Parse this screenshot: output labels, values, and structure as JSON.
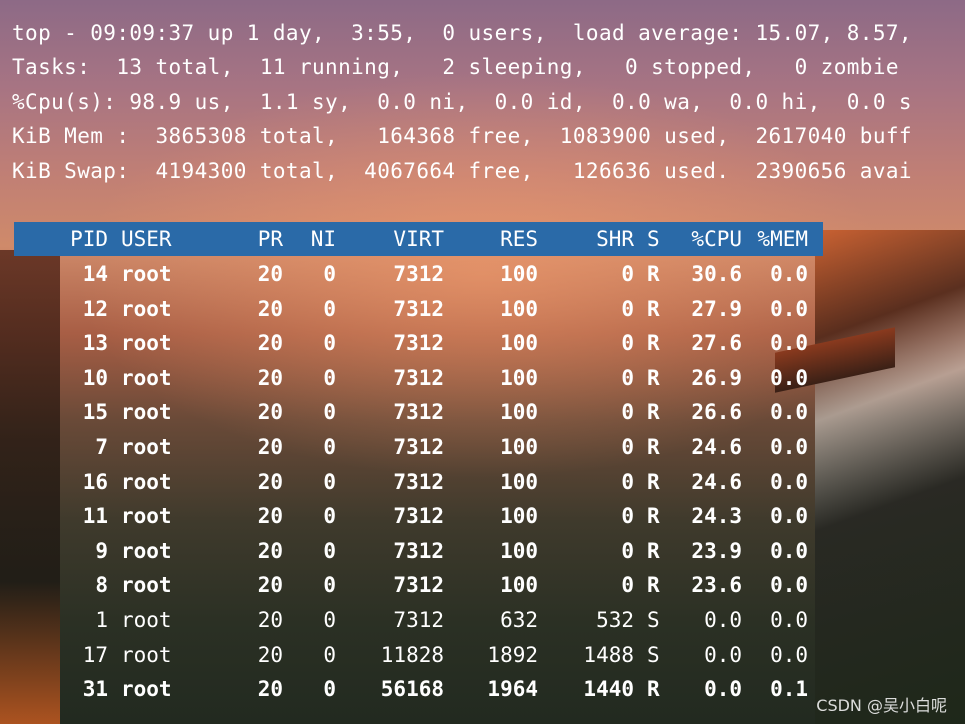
{
  "summary": [
    "top - 09:09:37 up 1 day,  3:55,  0 users,  load average: 15.07, 8.57,",
    "Tasks:  13 total,  11 running,   2 sleeping,   0 stopped,   0 zombie",
    "%Cpu(s): 98.9 us,  1.1 sy,  0.0 ni,  0.0 id,  0.0 wa,  0.0 hi,  0.0 s",
    "KiB Mem :  3865308 total,   164368 free,  1083900 used,  2617040 buff",
    "KiB Swap:  4194300 total,  4067664 free,   126636 used.  2390656 avai"
  ],
  "headers": {
    "pid": "PID",
    "user": "USER",
    "pr": "PR",
    "ni": "NI",
    "virt": "VIRT",
    "res": "RES",
    "shr": "SHR",
    "s": "S",
    "cpu": "%CPU",
    "mem": "%MEM"
  },
  "processes": [
    {
      "pid": "14",
      "user": "root",
      "pr": "20",
      "ni": "0",
      "virt": "7312",
      "res": "100",
      "shr": "0",
      "s": "R",
      "cpu": "30.6",
      "mem": "0.0",
      "bold": true
    },
    {
      "pid": "12",
      "user": "root",
      "pr": "20",
      "ni": "0",
      "virt": "7312",
      "res": "100",
      "shr": "0",
      "s": "R",
      "cpu": "27.9",
      "mem": "0.0",
      "bold": true
    },
    {
      "pid": "13",
      "user": "root",
      "pr": "20",
      "ni": "0",
      "virt": "7312",
      "res": "100",
      "shr": "0",
      "s": "R",
      "cpu": "27.6",
      "mem": "0.0",
      "bold": true
    },
    {
      "pid": "10",
      "user": "root",
      "pr": "20",
      "ni": "0",
      "virt": "7312",
      "res": "100",
      "shr": "0",
      "s": "R",
      "cpu": "26.9",
      "mem": "0.0",
      "bold": true
    },
    {
      "pid": "15",
      "user": "root",
      "pr": "20",
      "ni": "0",
      "virt": "7312",
      "res": "100",
      "shr": "0",
      "s": "R",
      "cpu": "26.6",
      "mem": "0.0",
      "bold": true
    },
    {
      "pid": "7",
      "user": "root",
      "pr": "20",
      "ni": "0",
      "virt": "7312",
      "res": "100",
      "shr": "0",
      "s": "R",
      "cpu": "24.6",
      "mem": "0.0",
      "bold": true
    },
    {
      "pid": "16",
      "user": "root",
      "pr": "20",
      "ni": "0",
      "virt": "7312",
      "res": "100",
      "shr": "0",
      "s": "R",
      "cpu": "24.6",
      "mem": "0.0",
      "bold": true
    },
    {
      "pid": "11",
      "user": "root",
      "pr": "20",
      "ni": "0",
      "virt": "7312",
      "res": "100",
      "shr": "0",
      "s": "R",
      "cpu": "24.3",
      "mem": "0.0",
      "bold": true
    },
    {
      "pid": "9",
      "user": "root",
      "pr": "20",
      "ni": "0",
      "virt": "7312",
      "res": "100",
      "shr": "0",
      "s": "R",
      "cpu": "23.9",
      "mem": "0.0",
      "bold": true
    },
    {
      "pid": "8",
      "user": "root",
      "pr": "20",
      "ni": "0",
      "virt": "7312",
      "res": "100",
      "shr": "0",
      "s": "R",
      "cpu": "23.6",
      "mem": "0.0",
      "bold": true
    },
    {
      "pid": "1",
      "user": "root",
      "pr": "20",
      "ni": "0",
      "virt": "7312",
      "res": "632",
      "shr": "532",
      "s": "S",
      "cpu": "0.0",
      "mem": "0.0",
      "bold": false
    },
    {
      "pid": "17",
      "user": "root",
      "pr": "20",
      "ni": "0",
      "virt": "11828",
      "res": "1892",
      "shr": "1488",
      "s": "S",
      "cpu": "0.0",
      "mem": "0.0",
      "bold": false
    },
    {
      "pid": "31",
      "user": "root",
      "pr": "20",
      "ni": "0",
      "virt": "56168",
      "res": "1964",
      "shr": "1440",
      "s": "R",
      "cpu": "0.0",
      "mem": "0.1",
      "bold": true
    }
  ],
  "watermark": "CSDN @吴小白呢"
}
